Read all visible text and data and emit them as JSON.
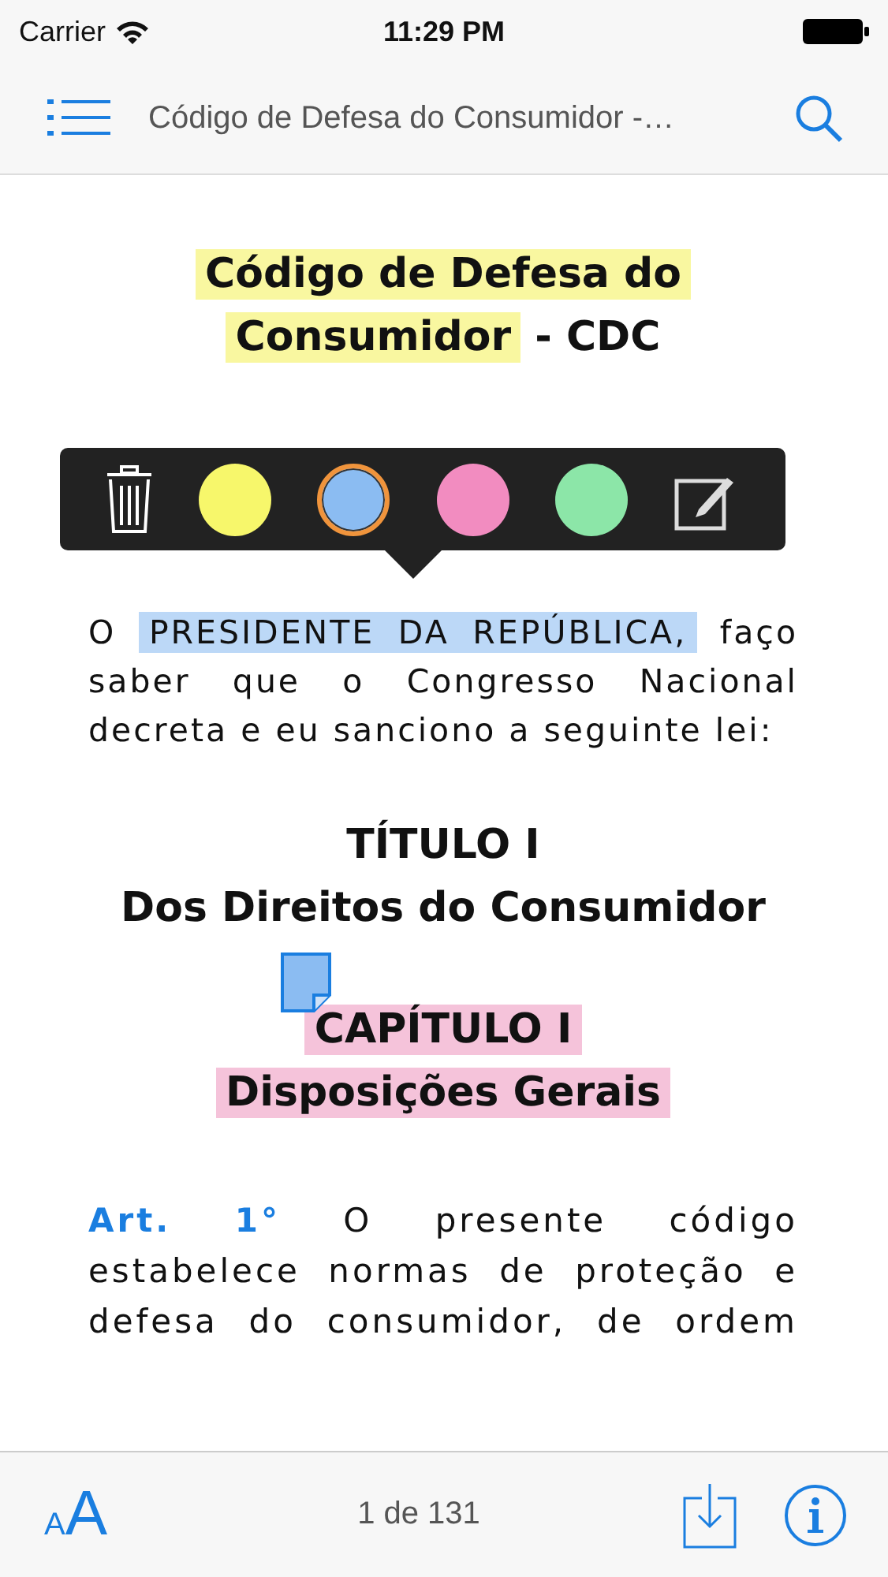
{
  "status_bar": {
    "carrier": "Carrier",
    "time": "11:29 PM"
  },
  "nav_bar": {
    "title": "Código de Defesa do Consumidor -…"
  },
  "document": {
    "blocks": [
      {
        "kind": "heading",
        "lines": [
          [
            {
              "text": "Código de Defesa do",
              "color": "#f9f7a0"
            }
          ],
          [
            {
              "text": "Consumidor",
              "color": "#f9f7a0"
            },
            {
              "text": " - CDC"
            }
          ]
        ]
      },
      {
        "kind": "popover",
        "items": [
          {
            "kind": "trash"
          },
          {
            "kind": "color",
            "color": "#f7f76b",
            "selected": false
          },
          {
            "kind": "color",
            "color": "#8bbcf2",
            "selected": true
          },
          {
            "kind": "color",
            "color": "#f28cc0",
            "selected": false
          },
          {
            "kind": "color",
            "color": "#8ce6a8",
            "selected": false
          },
          {
            "kind": "note"
          }
        ]
      },
      {
        "kind": "paragraph",
        "segments": [
          {
            "text": "O "
          },
          {
            "text": "PRESIDENTE DA REPÚBLICA,",
            "color": "#bcd8f7"
          },
          {
            "text": " faço saber que o Congresso Nacional decreta e eu sanciono a seguinte lei:"
          }
        ]
      },
      {
        "kind": "heading",
        "lines": [
          [
            {
              "text": "TÍTULO I"
            }
          ],
          [
            {
              "text": "Dos Direitos do Consumidor"
            }
          ]
        ]
      },
      {
        "kind": "heading",
        "note": true,
        "lines": [
          [
            {
              "text": "CAPÍTULO I",
              "color": "#f5c3da"
            }
          ],
          [
            {
              "text": "Disposições Gerais",
              "color": "#f5c3da"
            }
          ]
        ]
      },
      {
        "kind": "article",
        "label": "Art. 1°",
        "text": "O presente código estabelece normas de proteção e defesa do consumidor, de ordem"
      }
    ]
  },
  "toolbar": {
    "font_glyphs": [
      "A",
      "A"
    ],
    "page": "1 de 131"
  }
}
